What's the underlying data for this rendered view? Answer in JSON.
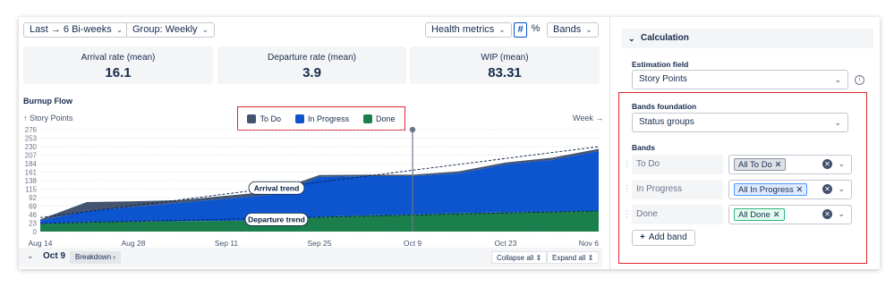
{
  "toolbar": {
    "range_label": "Last → 6 Bi-weeks",
    "group_label": "Group: Weekly",
    "health_label": "Health metrics",
    "hash_icon": "#",
    "percent_icon": "%",
    "bands_label": "Bands"
  },
  "metrics": [
    {
      "label": "Arrival rate (mean)",
      "value": "16.1"
    },
    {
      "label": "Departure rate (mean)",
      "value": "3.9"
    },
    {
      "label": "WIP (mean)",
      "value": "83.31"
    }
  ],
  "chart": {
    "title": "Burnup Flow",
    "y_axis_label": "↑ Story Points",
    "x_axis_label": "Week →",
    "legend": [
      {
        "label": "To Do",
        "color": "#44546f"
      },
      {
        "label": "In Progress",
        "color": "#0c55cf"
      },
      {
        "label": "Done",
        "color": "#1b7f4c"
      }
    ],
    "annotations": {
      "arrival_trend": "Arrival trend",
      "departure_trend": "Departure trend"
    }
  },
  "chart_data": {
    "type": "area",
    "title": "Burnup Flow",
    "xlabel": "Week",
    "ylabel": "Story Points",
    "ylim": [
      0,
      276
    ],
    "y_ticks": [
      "0",
      "23",
      "46",
      "69",
      "92",
      "115",
      "138",
      "161",
      "184",
      "207",
      "230",
      "253",
      "276"
    ],
    "x_ticks": [
      "Aug 14",
      "Aug 28",
      "Sep 11",
      "Sep 25",
      "Oct 9",
      "Oct 23",
      "Nov 6"
    ],
    "x_points": [
      "Aug 14",
      "Aug 21",
      "Aug 28",
      "Sep 4",
      "Sep 11",
      "Sep 18",
      "Sep 25",
      "Oct 2",
      "Oct 9",
      "Oct 16",
      "Oct 23",
      "Oct 30",
      "Nov 6"
    ],
    "stacked": true,
    "series": [
      {
        "name": "Done",
        "color": "#1b7f4c",
        "values": [
          20,
          26,
          27,
          28,
          29,
          30,
          40,
          44,
          46,
          50,
          52,
          54,
          56
        ]
      },
      {
        "name": "In Progress",
        "color": "#0c55cf",
        "values": [
          10,
          30,
          40,
          50,
          60,
          70,
          108,
          106,
          104,
          108,
          130,
          140,
          162
        ]
      },
      {
        "name": "To Do",
        "color": "#44546f",
        "values": [
          3,
          24,
          15,
          7,
          8,
          9,
          5,
          4,
          4,
          5,
          5,
          6,
          6
        ]
      }
    ],
    "trend_lines": [
      {
        "name": "Arrival trend",
        "from": [
          "Aug 14",
          38
        ],
        "to": [
          "Nov 6",
          230
        ]
      },
      {
        "name": "Departure trend",
        "from": [
          "Aug 14",
          22
        ],
        "to": [
          "Nov 6",
          56
        ]
      }
    ],
    "marker": "Oct 9",
    "grid": true,
    "legend_position": "top-center"
  },
  "breakdown_bar": {
    "date": "Oct 9",
    "breakdown_label": "Breakdown",
    "collapse_label": "Collapse all",
    "expand_label": "Expand all"
  },
  "panel": {
    "section_title": "Calculation",
    "estimation_label": "Estimation field",
    "estimation_value": "Story Points",
    "foundation_label": "Bands foundation",
    "foundation_value": "Status groups",
    "bands_label": "Bands",
    "bands": [
      {
        "name": "To Do",
        "chip": "All To Do",
        "chip_color": "#dfe1e6",
        "chip_border": "#8993a4"
      },
      {
        "name": "In Progress",
        "chip": "All In Progress",
        "chip_color": "#deebff",
        "chip_border": "#4c9aff"
      },
      {
        "name": "Done",
        "chip": "All Done",
        "chip_color": "#e3fcef",
        "chip_border": "#36b37e"
      }
    ],
    "add_band_label": "Add band"
  }
}
